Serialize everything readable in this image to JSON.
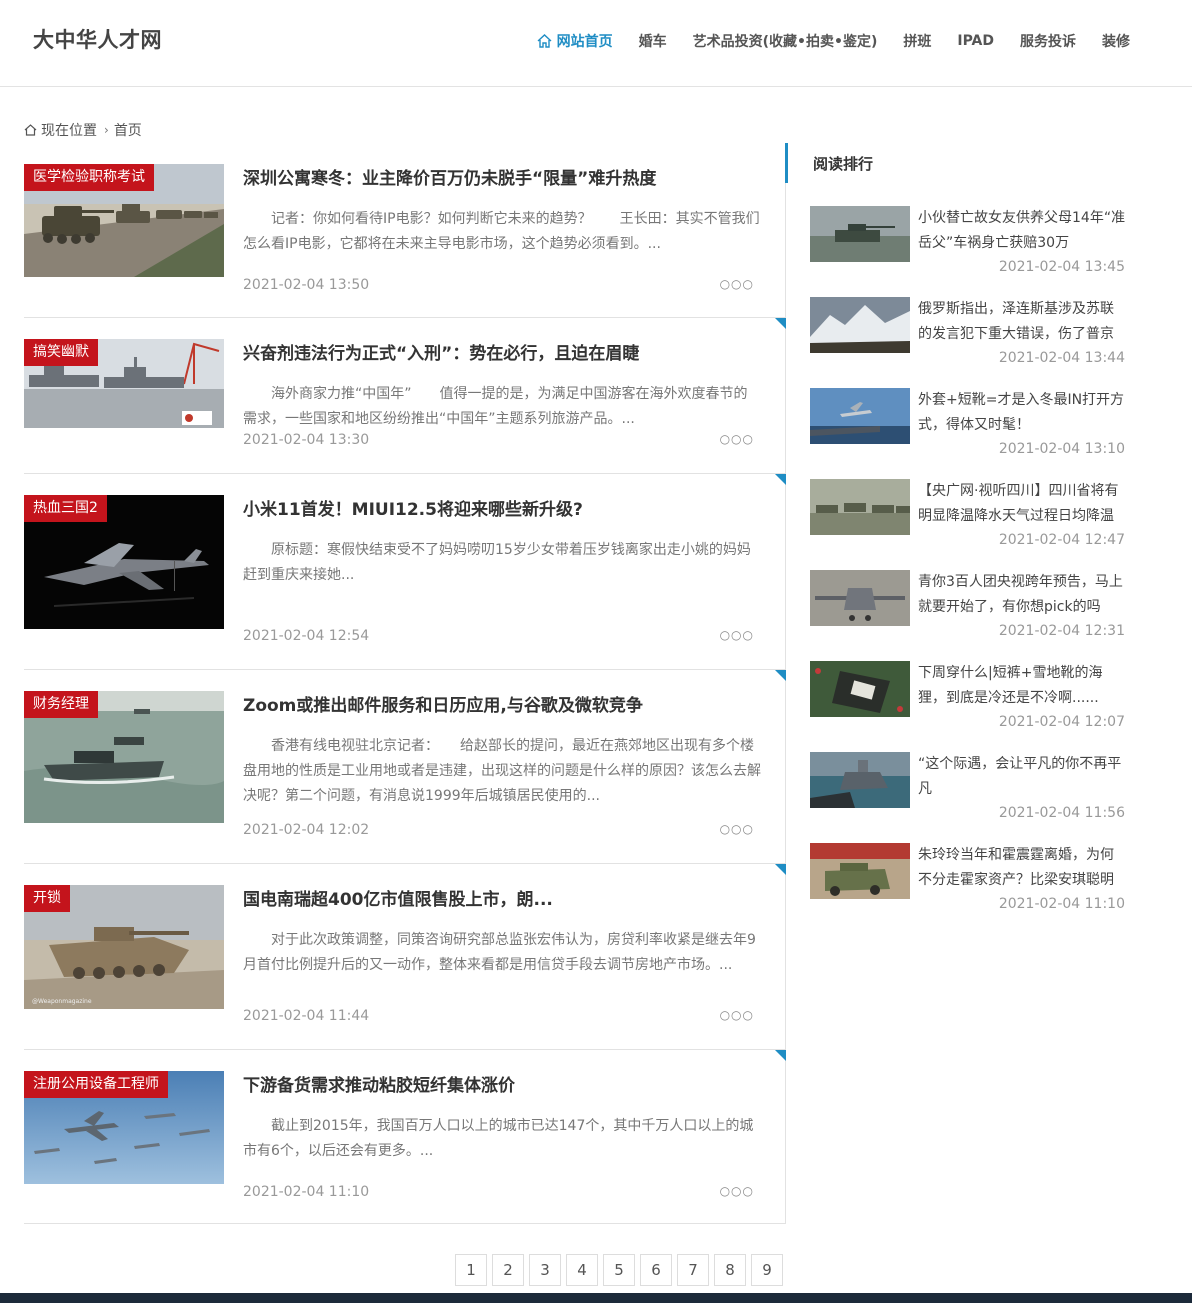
{
  "header": {
    "logo": "大中华人才网",
    "nav": [
      {
        "label": "网站首页",
        "active": true
      },
      {
        "label": "婚车"
      },
      {
        "label": "艺术品投资(收藏•拍卖•鉴定)"
      },
      {
        "label": "拼班"
      },
      {
        "label": "IPAD"
      },
      {
        "label": "服务投诉"
      },
      {
        "label": "装修"
      }
    ]
  },
  "breadcrumb": {
    "label": "现在位置",
    "current": "首页"
  },
  "articles": [
    {
      "tag": "医学检验职称考试",
      "title": "深圳公寓寒冬：业主降价百万仍未脱手“限量”难升热度",
      "summary": "记者：你如何看待IP电影？如何判断它未来的趋势？　　王长田：其实不管我们怎么看IP电影，它都将在未来主导电影市场，这个趋势必须看到。...",
      "date": "2021-02-04 13:50",
      "more": "○○○",
      "thumb": "tanks-road"
    },
    {
      "tag": "搞笑幽默",
      "title": "兴奋剂违法行为正式“入刑”：势在必行，且迫在眉睫",
      "summary": "海外商家力推“中国年”　　值得一提的是，为满足中国游客在海外欢度春节的需求，一些国家和地区纷纷推出“中国年”主题系列旅游产品。...",
      "date": "2021-02-04 13:30",
      "more": "○○○",
      "thumb": "warships-port"
    },
    {
      "tag": "热血三国2",
      "title": "小米11首发！MIUI12.5将迎来哪些新升级?",
      "summary": "原标题：寒假快结束受不了妈妈唠叨15岁少女带着压岁钱离家出走小姚的妈妈赶到重庆来接她...",
      "date": "2021-02-04 12:54",
      "more": "○○○",
      "thumb": "jet-dark"
    },
    {
      "tag": "财务经理",
      "title": "Zoom或推出邮件服务和日历应用,与谷歌及微软竞争",
      "summary": "香港有线电视驻北京记者：　　给赵部长的提问，最近在燕郊地区出现有多个楼盘用地的性质是工业用地或者是违建，出现这样的问题是什么样的原因？该怎么去解决呢？第二个问题，有消息说1999年后城镇居民使用的...",
      "date": "2021-02-04 12:02",
      "more": "○○○",
      "thumb": "amphibious"
    },
    {
      "tag": "开锁",
      "title": "国电南瑞超400亿市值限售股上市，朗...",
      "summary": "对于此次政策调整，同策咨询研究部总监张宏伟认为，房贷利率收紧是继去年9月首付比例提升后的又一动作，整体来看都是用信贷手段去调节房地产市场。...",
      "date": "2021-02-04 11:44",
      "more": "○○○",
      "thumb": "desert-tank"
    },
    {
      "tag": "注册公用设备工程师",
      "title": "下游备货需求推动粘胶短纤集体涨价",
      "summary": "截止到2015年，我国百万人口以上的城市已达147个，其中千万人口以上的城市有6个，以后还会有更多。...",
      "date": "2021-02-04 11:10",
      "more": "○○○",
      "thumb": "jets-sky"
    }
  ],
  "pagination": [
    "1",
    "2",
    "3",
    "4",
    "5",
    "6",
    "7",
    "8",
    "9"
  ],
  "sidebar": {
    "title": "阅读排行",
    "items": [
      {
        "text": "小伙替亡故女友供养父母14年“准岳父”车祸身亡获赔30万",
        "date": "2021-02-04 13:45",
        "thumb": "tank-field"
      },
      {
        "text": "俄罗斯指出，泽连斯基涉及苏联的发言犯下重大错误，伤了普京",
        "date": "2021-02-04 13:44",
        "thumb": "mountains"
      },
      {
        "text": "外套+短靴=才是入冬最IN打开方式，得体又时髦！",
        "date": "2021-02-04 13:10",
        "thumb": "carrier-jet"
      },
      {
        "text": "【央广网·视听四川】四川省将有明显降温降水天气过程日均降温",
        "date": "2021-02-04 12:47",
        "thumb": "tanks-column"
      },
      {
        "text": "青你3百人团央视跨年预告，马上就要开始了，有你想pick的吗",
        "date": "2021-02-04 12:31",
        "thumb": "drone"
      },
      {
        "text": "下周穿什么|短裤+雪地靴的海狸，到底是冷还是不冷啊......",
        "date": "2021-02-04 12:07",
        "thumb": "parade-flag"
      },
      {
        "text": "“这个际遇，会让平凡的你不再平凡",
        "date": "2021-02-04 11:56",
        "thumb": "ship-sea"
      },
      {
        "text": "朱玲玲当年和霍震霆离婚，为何不分走霍家资产？比梁安琪聪明",
        "date": "2021-02-04 11:10",
        "thumb": "parade-vehicle"
      }
    ]
  },
  "colors": {
    "accent": "#1f8dc4",
    "tag": "#c4141c",
    "footer": "#1c2a3a"
  }
}
